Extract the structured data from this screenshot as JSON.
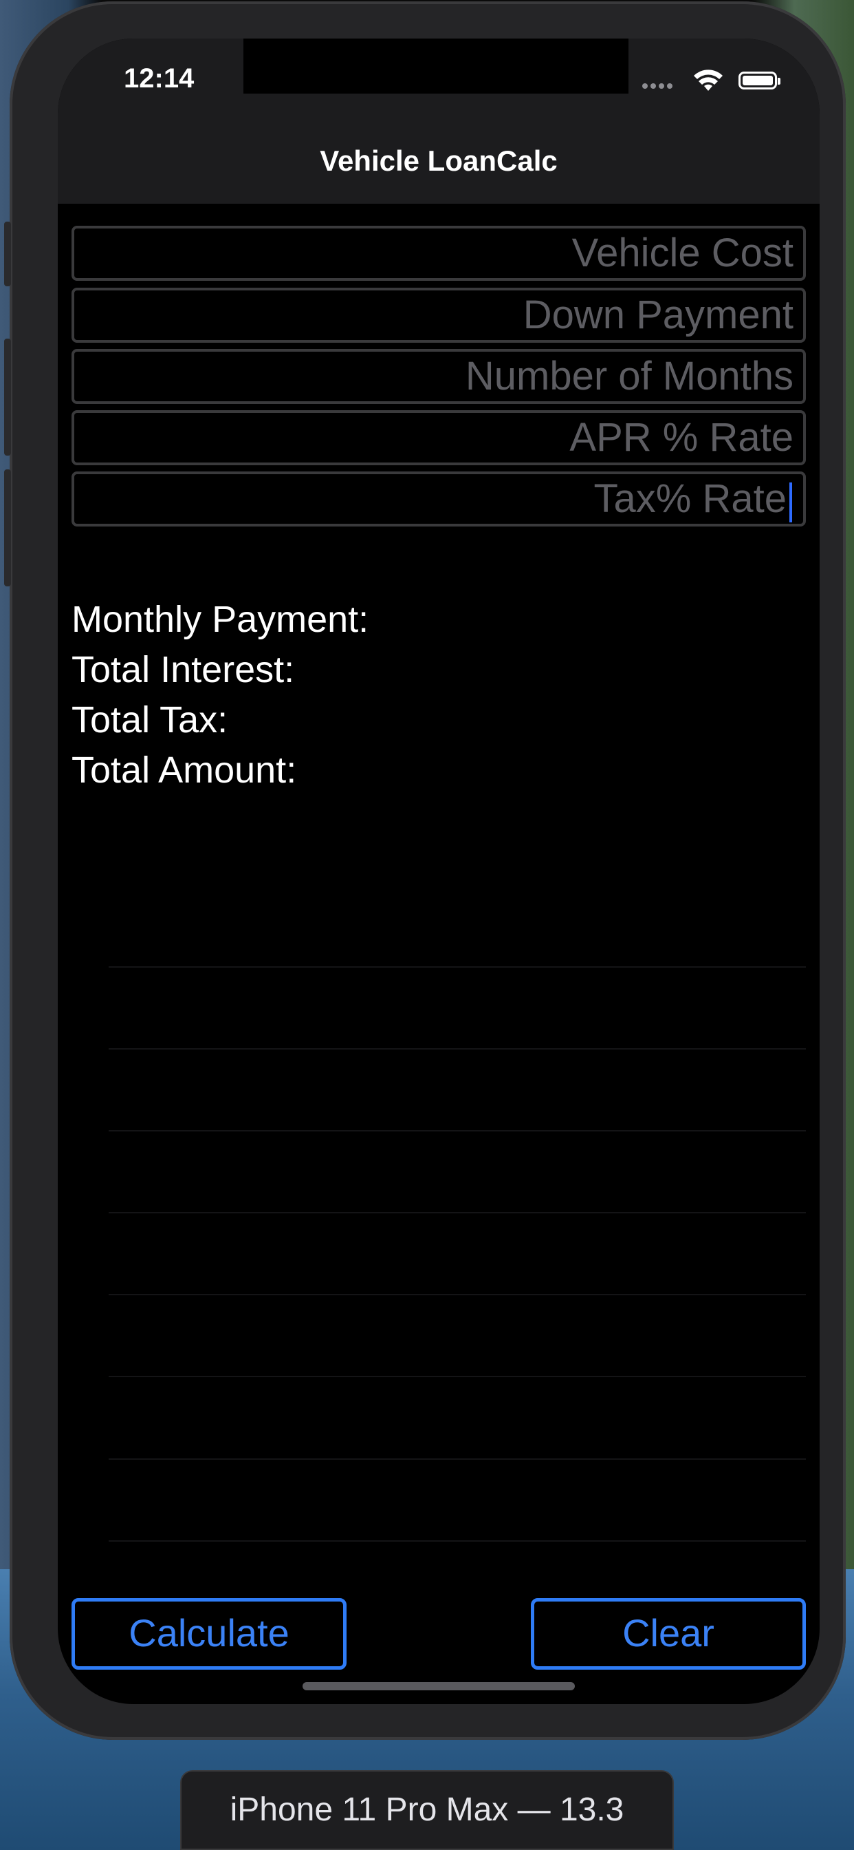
{
  "status_bar": {
    "time": "12:14"
  },
  "nav": {
    "title": "Vehicle LoanCalc"
  },
  "inputs": [
    {
      "placeholder": "Vehicle Cost"
    },
    {
      "placeholder": "Down Payment"
    },
    {
      "placeholder": "Number of Months"
    },
    {
      "placeholder": "APR % Rate"
    },
    {
      "placeholder": "Tax% Rate"
    }
  ],
  "results": {
    "monthly_payment": "Monthly Payment:",
    "total_interest": "Total Interest:",
    "total_tax": "Total Tax:",
    "total_amount": "Total Amount:"
  },
  "buttons": {
    "calculate": "Calculate",
    "clear": "Clear"
  },
  "simulator": {
    "device_label": "iPhone 11 Pro Max — 13.3"
  },
  "colors": {
    "accent": "#2f7cf6",
    "background": "#000000",
    "nav_bar": "#1c1c1e",
    "placeholder": "#5d5d62"
  }
}
